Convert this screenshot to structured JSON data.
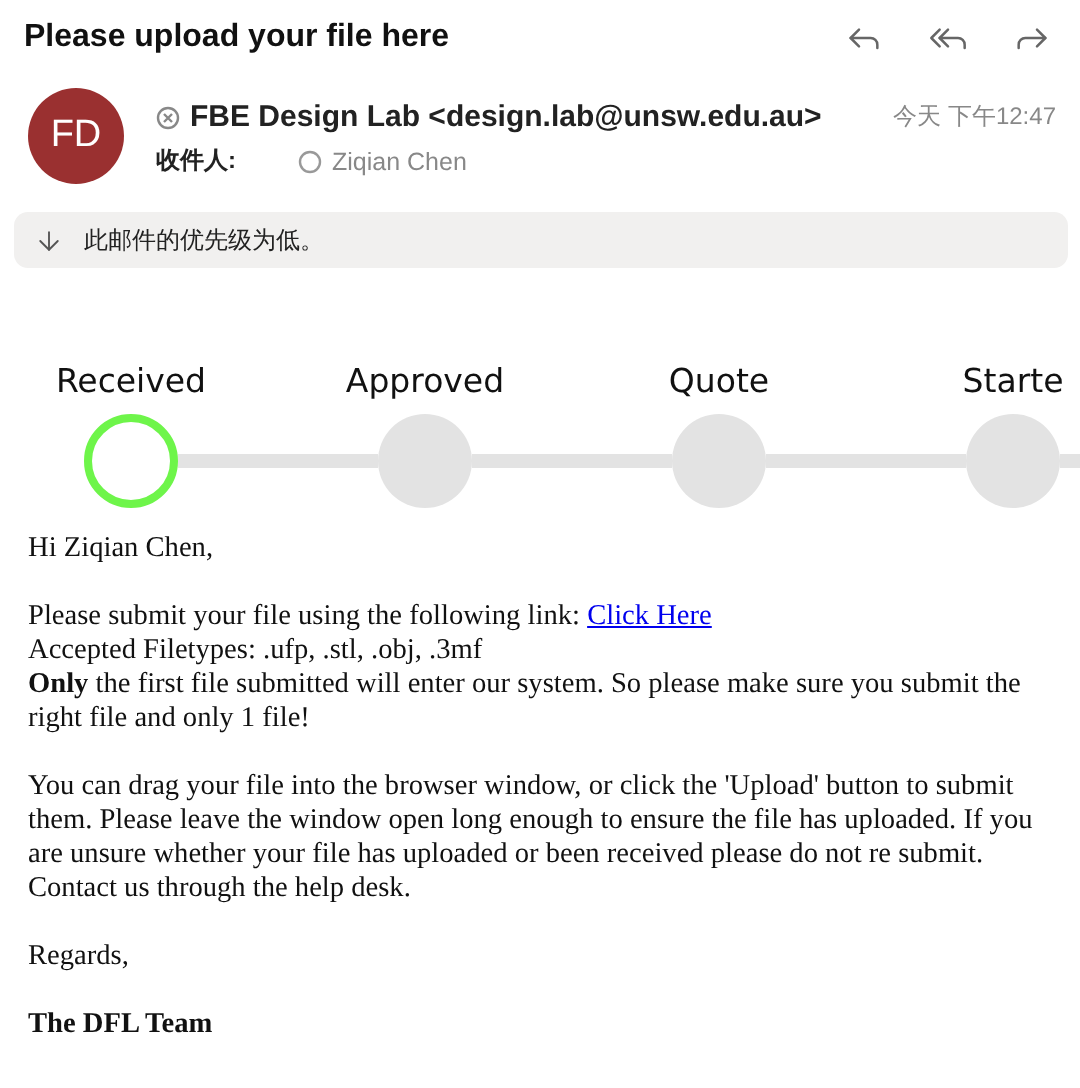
{
  "email": {
    "subject": "Please upload your file here",
    "sender": {
      "initials": "FD",
      "name": "FBE Design Lab <design.lab@unsw.edu.au>"
    },
    "recipients_label": "收件人:",
    "recipient": "Ziqian Chen",
    "time": "今天 下午12:47",
    "priority_notice": "此邮件的优先级为低。"
  },
  "progress": {
    "steps": [
      {
        "label": "Received",
        "selected": true
      },
      {
        "label": "Approved",
        "selected": false
      },
      {
        "label": "Quote",
        "selected": false
      },
      {
        "label": "Starte",
        "selected": false
      }
    ]
  },
  "body": {
    "greeting": "Hi Ziqian Chen,",
    "link_line": {
      "text": "Please submit your file using the following link:",
      "link": "Click Here"
    },
    "filetypes": "Accepted Filetypes: .ufp, .stl, .obj, .3mf",
    "notice": "**Only** the first file submitted will enter our system. So please make sure you submit the right file and only 1 file!",
    "instructions": "You can drag your file into the browser window, or click the 'Upload' button to submit them. Please leave the window open long enough to ensure the file has uploaded. If you are unsure whether your file has uploaded or been received please do not re submit. Contact us through the help desk.",
    "closing": "Regards,",
    "signature": "The DFL Team"
  }
}
